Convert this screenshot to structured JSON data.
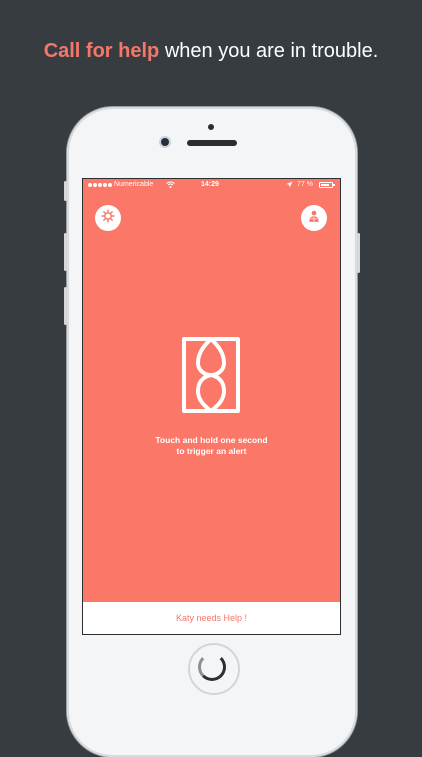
{
  "headline": {
    "accent": "Call for help",
    "rest": " when you are in trouble."
  },
  "status_bar": {
    "carrier": "Numericable",
    "time": "14:29",
    "battery_percent": "77 %",
    "battery_level": 0.77
  },
  "icons": {
    "settings": "gear-icon",
    "contact": "contact-icon",
    "alert": "alert-icon"
  },
  "main": {
    "instruction_line1": "Touch and hold one second",
    "instruction_line2": "to trigger an alert"
  },
  "bottom_bar": {
    "label": "Katy needs Help !"
  },
  "colors": {
    "accent": "#f6766a",
    "screen_background": "#fb7767",
    "page_background": "#363c3f"
  }
}
